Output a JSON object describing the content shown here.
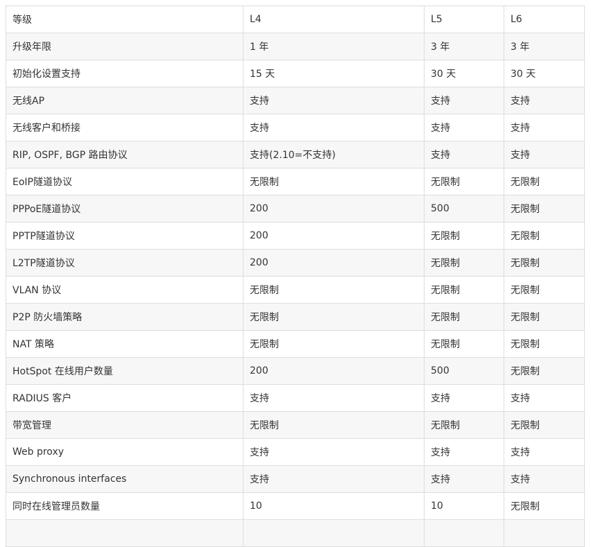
{
  "header": [
    "等级",
    "L4",
    "L5",
    "L6"
  ],
  "rows": [
    [
      "升级年限",
      " 1 年",
      " 3 年",
      " 3 年"
    ],
    [
      "初始化设置支持",
      " 15 天",
      "30 天",
      "30 天"
    ],
    [
      "无线AP",
      "支持",
      "支持",
      "支持"
    ],
    [
      "无线客户和桥接",
      "支持",
      "支持",
      "支持"
    ],
    [
      "RIP, OSPF, BGP 路由协议",
      "支持(2.10=不支持)",
      "支持",
      "支持"
    ],
    [
      "EoIP隧道协议",
      "无限制",
      "无限制",
      "无限制"
    ],
    [
      "PPPoE隧道协议",
      "200",
      "500",
      "无限制"
    ],
    [
      "PPTP隧道协议",
      "200",
      "无限制",
      "无限制"
    ],
    [
      "L2TP隧道协议",
      "200",
      "无限制",
      "无限制"
    ],
    [
      "VLAN 协议",
      "无限制",
      "无限制",
      "无限制"
    ],
    [
      "P2P 防火墙策略",
      "无限制",
      "无限制",
      "无限制"
    ],
    [
      "NAT 策略",
      "无限制",
      "无限制",
      "无限制"
    ],
    [
      "HotSpot 在线用户数量",
      "200",
      "500",
      "无限制"
    ],
    [
      "RADIUS 客户",
      "支持",
      "支持",
      "支持"
    ],
    [
      "带宽管理",
      "无限制",
      "无限制",
      "无限制"
    ],
    [
      "Web proxy",
      "支持",
      "支持",
      "支持"
    ],
    [
      "Synchronous interfaces",
      "支持",
      "支持",
      "支持"
    ],
    [
      "同时在线管理员数量",
      "10",
      "10",
      "无限制"
    ],
    [
      "",
      "",
      "",
      ""
    ]
  ]
}
